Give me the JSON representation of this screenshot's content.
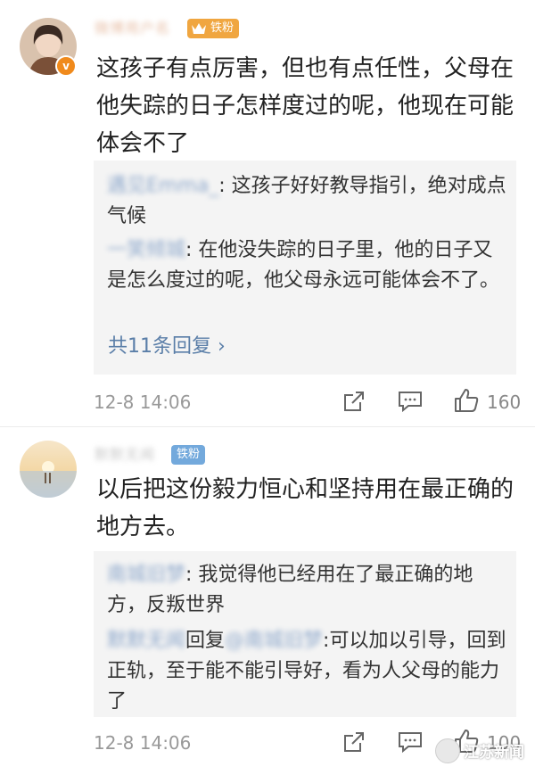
{
  "comments": [
    {
      "username": "微博用户名",
      "badge": "铁粉",
      "text": "这孩子有点厉害，但也有点任性，父母在他失踪的日子怎样度过的呢，他现在可能体会不了",
      "replies": [
        {
          "name": "遇见Emma_",
          "sep": ": ",
          "text": "这孩子好好教导指引，绝对成点气候"
        },
        {
          "name": "一笑倾城",
          "sep": ": ",
          "text": "在他没失踪的日子里，他的日子又是怎么度过的呢，他父母永远可能体会不了。"
        }
      ],
      "replies_link": "共11条回复 ›",
      "time": "12-8 14:06",
      "likes": "160"
    },
    {
      "username": "默默无闻",
      "badge": "铁粉",
      "text": "以后把这份毅力恒心和坚持用在最正确的地方去。",
      "replies": [
        {
          "name": "南城旧梦",
          "sep": ": ",
          "text": "我觉得他已经用在了最正确的地方，反叛世界"
        },
        {
          "name": "默默无闻",
          "mid": "回复",
          "name2": "@南城旧梦",
          "sep": ":",
          "text": "可以加以引导，回到正轨，至于能不能引导好，看为人父母的能力了"
        }
      ],
      "time": "12-8 14:06",
      "likes": "100"
    }
  ],
  "watermark": "江苏新闻",
  "icons": {
    "share": "share-icon",
    "comment": "comment-icon",
    "like": "thumbs-up-icon",
    "crown": "crown-icon",
    "verified": "verified-icon"
  },
  "colors": {
    "gold_badge": "#f0a640",
    "blue_badge": "#73a9dc",
    "link": "#5a7ea8",
    "reply_bg": "#f4f4f4"
  }
}
